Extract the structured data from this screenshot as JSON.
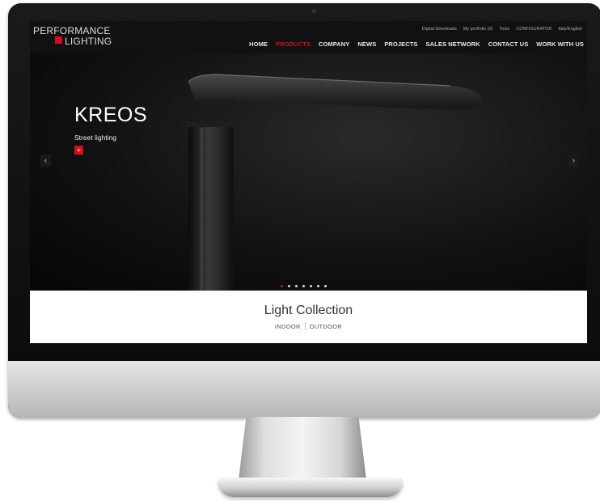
{
  "header": {
    "logo_line1": "PERFORMANCE",
    "logo_line2": "LIGHTING",
    "logo_mark": "",
    "util_nav": [
      "Digital downloads",
      "My portfolio (0)",
      "Tools",
      "CONFIGURATOR",
      "Italy/English"
    ],
    "main_nav": [
      "HOME",
      "PRODUCTS",
      "COMPANY",
      "NEWS",
      "PROJECTS",
      "SALES NETWORK",
      "CONTACT US",
      "WORK WITH US"
    ],
    "active_item": "PRODUCTS",
    "accent_color": "#d1101e"
  },
  "hero": {
    "title": "KREOS",
    "subtitle": "Street lighting",
    "plus_label": "+",
    "prev_label": "‹",
    "next_label": "›",
    "slide_count": 7,
    "active_slide": 1
  },
  "collection": {
    "title": "Light Collection",
    "indoor": "INDOOR",
    "outdoor": "OUTDOOR"
  }
}
